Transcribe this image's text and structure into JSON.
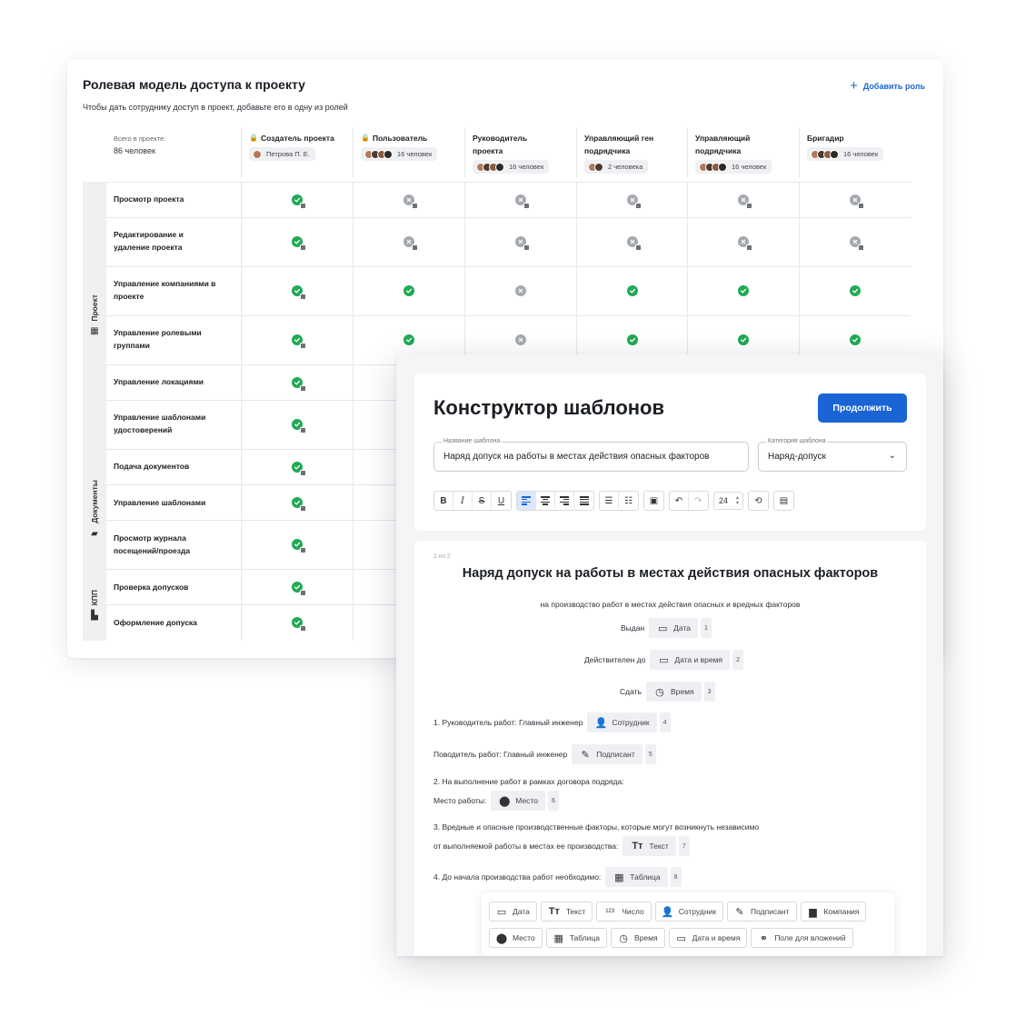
{
  "roles": {
    "title": "Ролевая модель доступа к проекту",
    "subtitle": "Чтобы дать сотруднику доступ в проект, добавьте его в одну из ролей",
    "add_role": "Добавить роль",
    "total_label": "Всего в проекте:",
    "total_value": "86 человек",
    "columns": [
      {
        "title": "Создатель проекта",
        "locked": true,
        "chip": "Петрова П. Е.",
        "avatars": 1
      },
      {
        "title": "Пользователь",
        "locked": true,
        "chip": "16 человек",
        "avatars": 4
      },
      {
        "title": "Руководитель проекта",
        "locked": false,
        "chip": "16 человек",
        "avatars": 4
      },
      {
        "title": "Управляющий ген подрядчика",
        "locked": false,
        "chip": "2 человека",
        "avatars": 2
      },
      {
        "title": "Управляющий подрядчика",
        "locked": false,
        "chip": "16 человек",
        "avatars": 4
      },
      {
        "title": "Бригадир",
        "locked": false,
        "chip": "16 человек",
        "avatars": 4
      }
    ],
    "sections": [
      {
        "name": "Проект",
        "icon": "building-icon"
      },
      {
        "name": "Документы",
        "icon": "folder-icon"
      },
      {
        "name": "КПП",
        "icon": "barrier-icon"
      }
    ],
    "permissions": [
      {
        "label": "Просмотр проекта",
        "states": [
          "yes-lock",
          "no-lock",
          "no-lock",
          "no-lock",
          "no-lock",
          "no-lock"
        ]
      },
      {
        "label": "Редактирование и удаление проекта",
        "states": [
          "yes-lock",
          "no-lock",
          "no-lock",
          "no-lock",
          "no-lock",
          "no-lock"
        ]
      },
      {
        "label": "Управление компаниями в проекте",
        "states": [
          "yes-lock",
          "yes",
          "no",
          "yes",
          "yes",
          "yes"
        ]
      },
      {
        "label": "Управление ролевыми группами",
        "states": [
          "yes-lock",
          "yes",
          "no",
          "yes",
          "yes",
          "yes"
        ]
      },
      {
        "label": "Управление локациями",
        "states": [
          "yes-lock"
        ]
      },
      {
        "label": "Управление шаблонами удостоверений",
        "states": [
          "yes-lock"
        ]
      },
      {
        "label": "Подача документов",
        "states": [
          "yes-lock"
        ]
      },
      {
        "label": "Управление шаблонами",
        "states": [
          "yes-lock"
        ]
      },
      {
        "label": "Просмотр журнала посещений/проезда",
        "states": [
          "yes-lock"
        ]
      },
      {
        "label": "Проверка допусков",
        "states": [
          "yes-lock"
        ]
      },
      {
        "label": "Оформление допуска",
        "states": [
          "yes-lock"
        ]
      }
    ]
  },
  "constructor": {
    "title": "Конструктор шаблонов",
    "continue_button": "Продолжить",
    "name_field": {
      "label": "Название шаблона",
      "value": "Наряд допуск на работы в местах действия опасных факторов"
    },
    "category_field": {
      "label": "Категория шаблона",
      "value": "Наряд-допуск"
    },
    "toolbar": {
      "bold": "B",
      "italic": "I",
      "strike": "S",
      "underline": "U",
      "font_size": "24"
    },
    "document": {
      "page": "1 из 2",
      "title": "Наряд допуск на работы в местах действия опасных факторов",
      "subtitle": "на производство работ в местах действия опасных и вредных факторов",
      "issued_label": "Выдан",
      "issued_tag": "Дата",
      "issued_num": "1",
      "valid_label": "Действителен до",
      "valid_tag": "Дата и время",
      "valid_num": "2",
      "return_label": "Сдать",
      "return_tag": "Время",
      "return_num": "3",
      "manager_label": "1. Руководитель работ: Главный инженер",
      "manager_tag": "Сотрудник",
      "manager_num": "4",
      "driver_label": "Поводитель работ: Главный инженер",
      "driver_tag": "Подписант",
      "driver_num": "5",
      "p2": "2. На выполнение работ в рамках договора подряда:",
      "place_label": "Место работы:",
      "place_tag": "Место",
      "place_num": "6",
      "p3a": "3. Вредные и опасные производственные факторы, которые могут возникнуть независимо",
      "p3b": "от выполняемой работы в местах ее производства:",
      "text_tag": "Текст",
      "text_num": "7",
      "p4": "4. До начала производства работ необходимо:",
      "table_tag": "Таблица",
      "table_num": "8"
    },
    "palette_row1": [
      "Дата",
      "Текст",
      "Число",
      "Сотрудник",
      "Подписант",
      "Компания"
    ],
    "palette_row2": [
      "Место",
      "Таблица",
      "Время",
      "Дата и время",
      "Поле для вложений"
    ]
  }
}
